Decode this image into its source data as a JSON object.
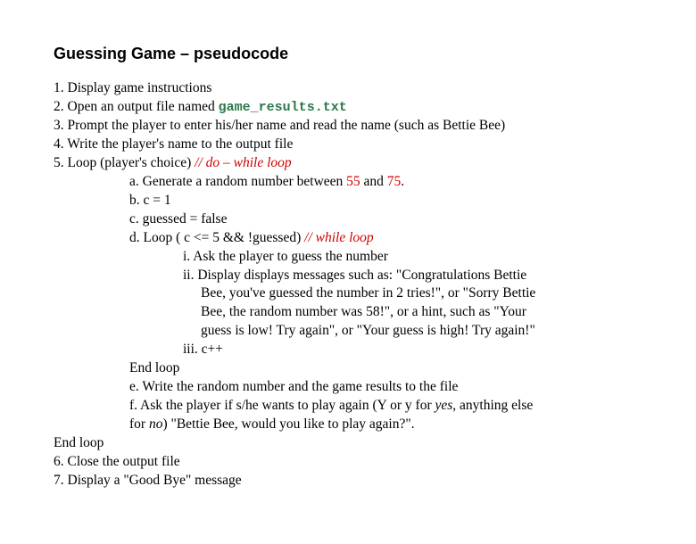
{
  "title": "Guessing Game – pseudocode",
  "lines": {
    "l1": "1. Display game instructions",
    "l2a": "2. Open an output file named ",
    "l2b": "game_results.txt",
    "l3": "3. Prompt the player to enter his/her name and read the name (such as Bettie Bee)",
    "l4": "4. Write the player's name to the output file",
    "l5a": "5. Loop (player's choice) ",
    "l5b": "// do – while loop",
    "l5a1a": "a. Generate a random number between ",
    "l5a1b": "55",
    "l5a1c": " and ",
    "l5a1d": "75",
    "l5a1e": ".",
    "l5b1": "b. c = 1",
    "l5c1": "c. guessed = false",
    "l5d1a": "d. Loop ( c <= 5 && !guessed) ",
    "l5d1b": "// while loop",
    "l5d_i": "i. Ask the player to guess the number",
    "l5d_ii": "ii. Display displays messages such as: \"Congratulations Bettie",
    "l5d_ii2": "Bee, you've guessed the number in 2 tries!\", or \"Sorry Bettie",
    "l5d_ii3": "Bee, the random number was 58!\", or a hint, such as \"Your",
    "l5d_ii4": "guess is low! Try again\", or \"Your guess is high! Try again!\"",
    "l5d_iii": "iii. c++",
    "l5end1": "End loop",
    "l5e": "e. Write the random number and the game results to the file",
    "l5f1": "f. Ask the player if s/he wants to play again (Y or y for ",
    "l5f_yes": "yes",
    "l5f2": ", anything else",
    "l5f3a": "for ",
    "l5f_no": "no",
    "l5f3b": ") \"Bettie Bee, would you like to play again?\".",
    "endloop": "End loop",
    "l6": "6. Close the output file",
    "l7": "7. Display a \"Good Bye\" message"
  }
}
